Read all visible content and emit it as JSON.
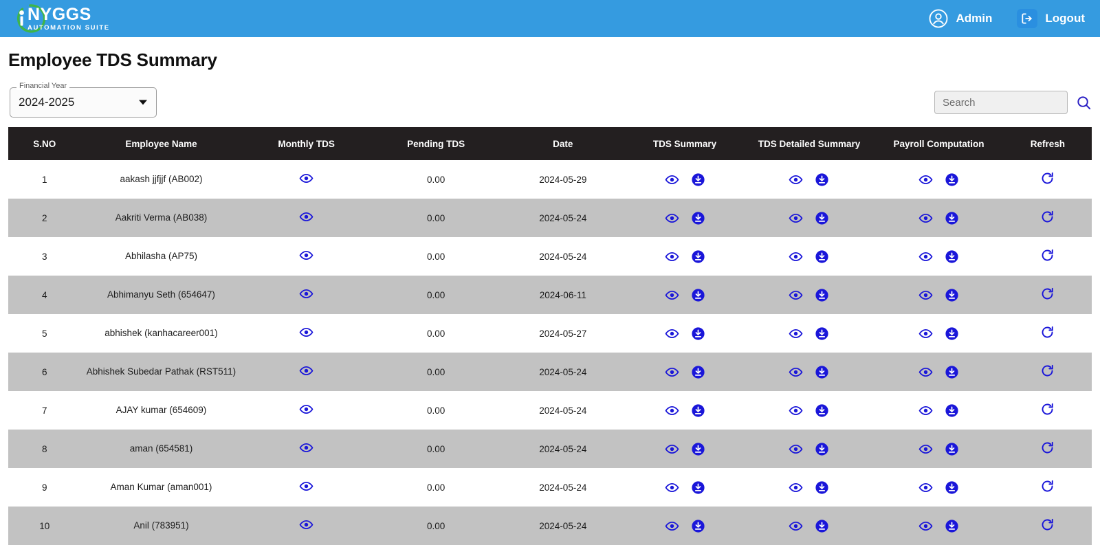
{
  "topbar": {
    "brand": {
      "title": "NYGGS",
      "subtitle": "AUTOMATION SUITE",
      "logo_icon": "nyggs-logo-icon"
    },
    "user": {
      "label": "Admin",
      "icon": "user-circle-icon"
    },
    "logout": {
      "label": "Logout",
      "icon": "logout-icon"
    },
    "background_color": "#359be0"
  },
  "page": {
    "title": "Employee TDS Summary"
  },
  "filters": {
    "financial_year": {
      "label": "Financial Year",
      "value": "2024-2025",
      "caret_icon": "chevron-down-icon"
    }
  },
  "search": {
    "placeholder": "Search",
    "value": "",
    "icon": "search-icon",
    "icon_color": "#2a1fc4"
  },
  "table": {
    "header_color": "#231f20",
    "row_alt_color": "#c2c2c2",
    "icon_color": "#1a16d9",
    "columns": [
      "S.NO",
      "Employee Name",
      "Monthly TDS",
      "Pending TDS",
      "Date",
      "TDS Summary",
      "TDS Detailed Summary",
      "Payroll Computation",
      "Refresh"
    ],
    "rows": [
      {
        "sno": "1",
        "name": "aakash jjfjjf (AB002)",
        "monthly_tds_icon": "eye-icon",
        "pending_tds": "0.00",
        "date": "2024-05-29"
      },
      {
        "sno": "2",
        "name": "Aakriti Verma (AB038)",
        "monthly_tds_icon": "eye-icon",
        "pending_tds": "0.00",
        "date": "2024-05-24"
      },
      {
        "sno": "3",
        "name": "Abhilasha (AP75)",
        "monthly_tds_icon": "eye-icon",
        "pending_tds": "0.00",
        "date": "2024-05-24"
      },
      {
        "sno": "4",
        "name": "Abhimanyu Seth (654647)",
        "monthly_tds_icon": "eye-icon",
        "pending_tds": "0.00",
        "date": "2024-06-11"
      },
      {
        "sno": "5",
        "name": "abhishek (kanhacareer001)",
        "monthly_tds_icon": "eye-icon",
        "pending_tds": "0.00",
        "date": "2024-05-27"
      },
      {
        "sno": "6",
        "name": "Abhishek Subedar Pathak (RST511)",
        "monthly_tds_icon": "eye-icon",
        "pending_tds": "0.00",
        "date": "2024-05-24"
      },
      {
        "sno": "7",
        "name": "AJAY kumar (654609)",
        "monthly_tds_icon": "eye-icon",
        "pending_tds": "0.00",
        "date": "2024-05-24"
      },
      {
        "sno": "8",
        "name": "aman (654581)",
        "monthly_tds_icon": "eye-icon",
        "pending_tds": "0.00",
        "date": "2024-05-24"
      },
      {
        "sno": "9",
        "name": "Aman Kumar (aman001)",
        "monthly_tds_icon": "eye-icon",
        "pending_tds": "0.00",
        "date": "2024-05-24"
      },
      {
        "sno": "10",
        "name": "Anil (783951)",
        "monthly_tds_icon": "eye-icon",
        "pending_tds": "0.00",
        "date": "2024-05-24"
      }
    ],
    "action_icons": {
      "view": "eye-icon",
      "download": "download-circle-icon",
      "refresh": "refresh-icon"
    }
  }
}
